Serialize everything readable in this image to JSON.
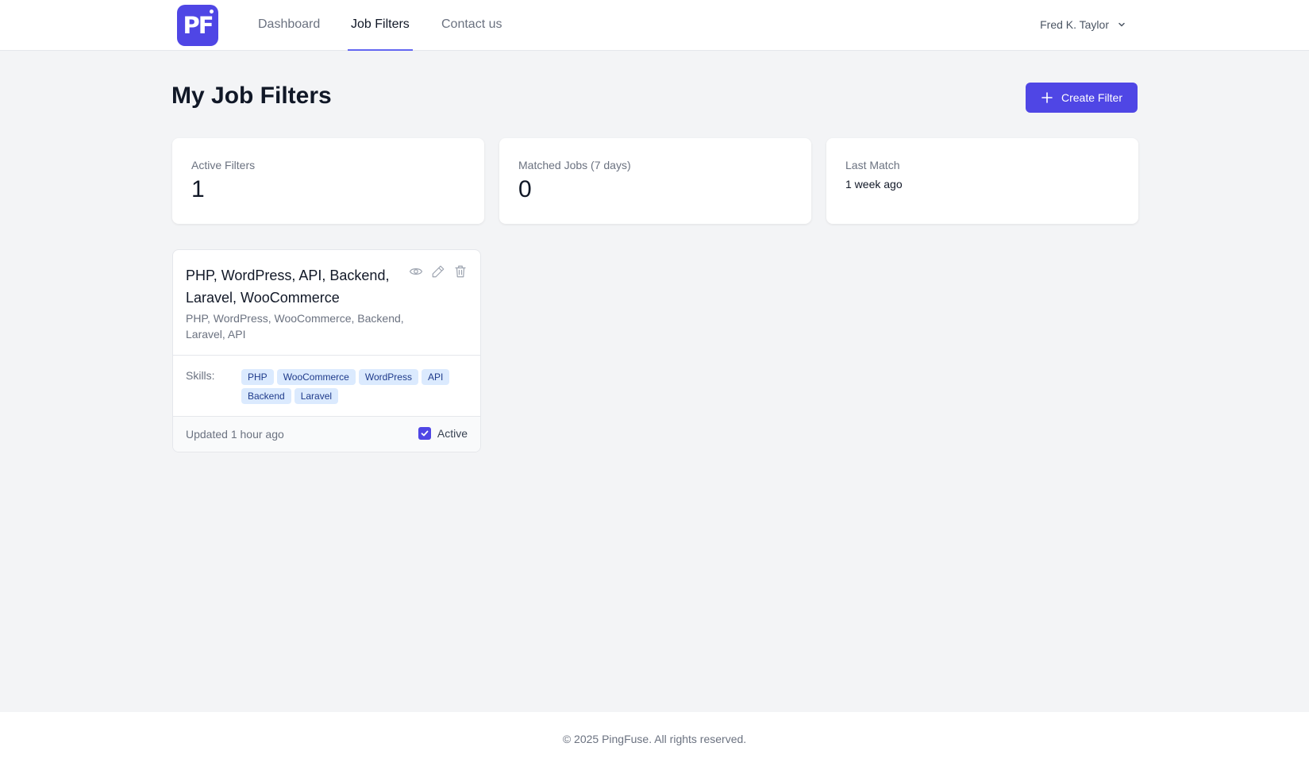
{
  "header": {
    "logo_text": "PF",
    "nav": [
      {
        "label": "Dashboard"
      },
      {
        "label": "Job Filters"
      },
      {
        "label": "Contact us"
      }
    ],
    "active_nav": "Job Filters",
    "user_name": "Fred K. Taylor"
  },
  "page": {
    "title": "My Job Filters",
    "create_button": "Create Filter"
  },
  "stats": [
    {
      "label": "Active Filters",
      "value": "1"
    },
    {
      "label": "Matched Jobs (7 days)",
      "value": "0"
    },
    {
      "label": "Last Match",
      "value": "1 week ago"
    }
  ],
  "filter_card": {
    "title": "PHP, WordPress, API, Backend, Laravel, WooCommerce",
    "description": "PHP, WordPress, WooCommerce, Backend, Laravel, API",
    "skills_label": "Skills:",
    "skills": [
      "PHP",
      "WooCommerce",
      "WordPress",
      "API",
      "Backend",
      "Laravel"
    ],
    "updated": "Updated 1 hour ago",
    "active_label": "Active",
    "active": true,
    "icons": [
      "eye-icon",
      "pencil-icon",
      "trash-icon"
    ]
  },
  "footer": {
    "copyright": "© 2025 PingFuse. All rights reserved."
  },
  "colors": {
    "accent": "#4f46e5",
    "tag_bg": "#dbeafe",
    "tag_text": "#1e3a8a",
    "background": "#f3f4f6"
  }
}
